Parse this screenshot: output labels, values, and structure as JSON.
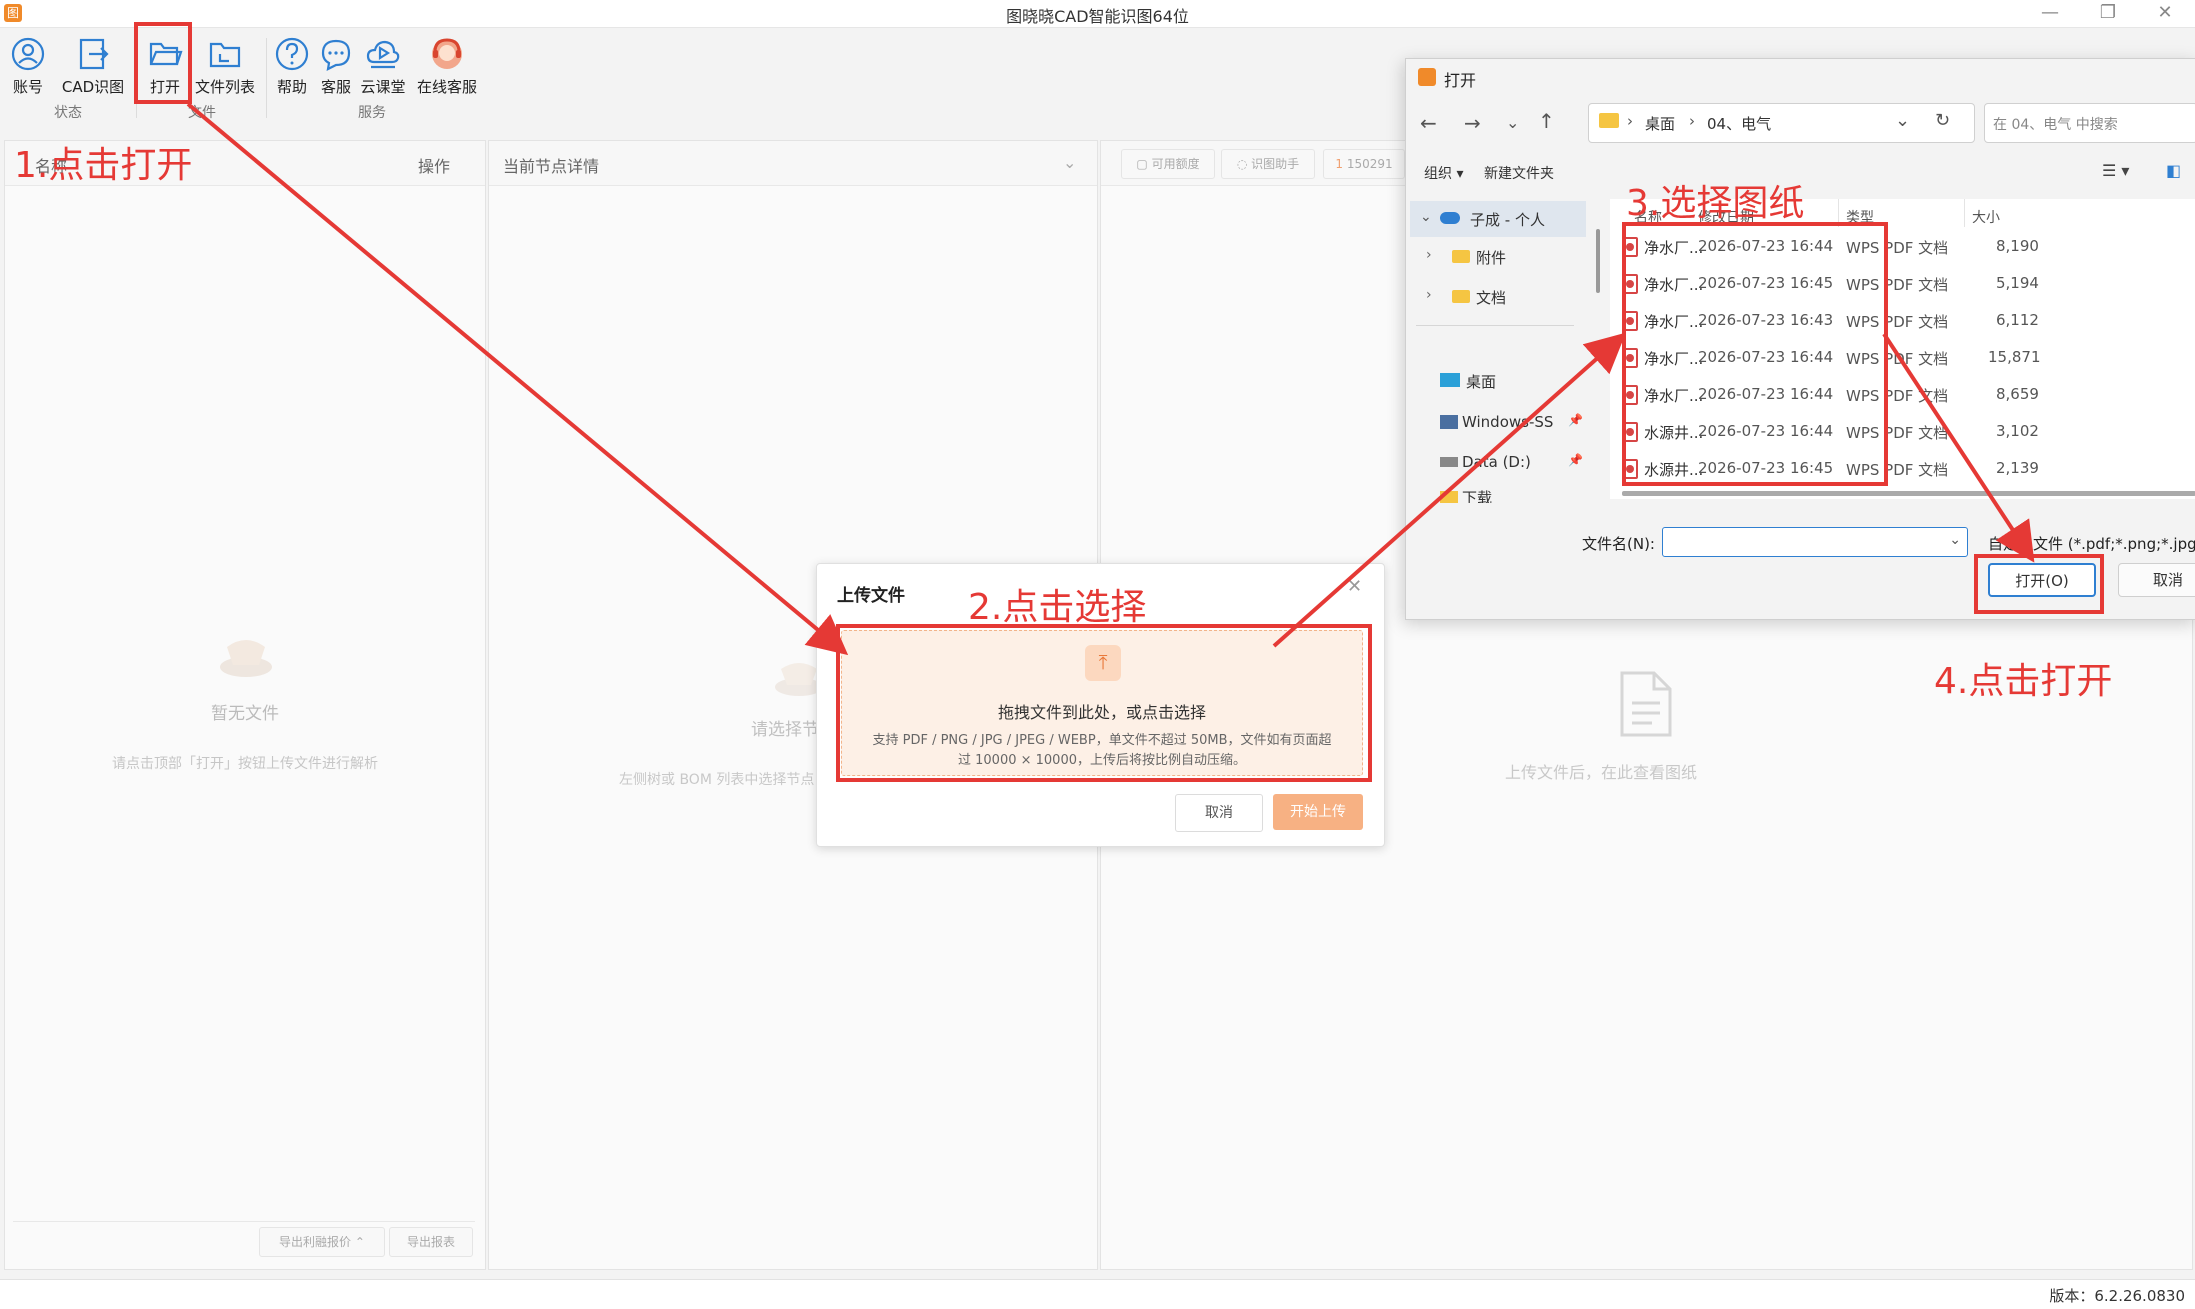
{
  "app": {
    "title": "图晓晓CAD智能识图64位",
    "version_label": "版本：6.2.26.0830"
  },
  "toolbar": {
    "items": [
      {
        "label": "账号"
      },
      {
        "label": "CAD识图"
      },
      {
        "label": "打开"
      },
      {
        "label": "文件列表"
      },
      {
        "label": "帮助"
      },
      {
        "label": "客服"
      },
      {
        "label": "云课堂"
      },
      {
        "label": "在线客服"
      }
    ],
    "groups": [
      "状态",
      "文件",
      "服务"
    ]
  },
  "left_panel": {
    "header_name": "名称",
    "header_action": "操作",
    "empty_title": "暂无文件",
    "empty_hint": "请点击顶部「打开」按钮上传文件进行解析",
    "btn_export_quote": "导出利融报价",
    "btn_export_report": "导出报表"
  },
  "mid_panel": {
    "header": "当前节点详情",
    "empty_title": "请选择节",
    "empty_hint": "左侧树或 BOM 列表中选择节点"
  },
  "right_panel": {
    "chip1": "可用额度",
    "chip2": "识图助手",
    "chip3_badge": "1",
    "chip3": "150291",
    "empty_hint": "上传文件后，在此查看图纸"
  },
  "upload_modal": {
    "title": "上传文件",
    "drop_main": "拖拽文件到此处，或点击选择",
    "drop_sub1": "支持 PDF / PNG / JPG / JPEG / WEBP，单文件不超过 50MB，文件如有页面超",
    "drop_sub2": "过 10000 × 10000，上传后将按比例自动压缩。",
    "cancel": "取消",
    "start": "开始上传"
  },
  "file_dialog": {
    "title": "打开",
    "path": [
      "桌面",
      "04、电气"
    ],
    "search_placeholder": "在 04、电气 中搜索",
    "organize": "组织 ▾",
    "new_folder": "新建文件夹",
    "nav": [
      {
        "label": "子成 - 个人"
      },
      {
        "label": "附件"
      },
      {
        "label": "文档"
      },
      {
        "label": "桌面"
      },
      {
        "label": "Windows-SS"
      },
      {
        "label": "Data (D:)"
      },
      {
        "label": "下载"
      }
    ],
    "columns": {
      "name": "名称",
      "date": "修改日期",
      "type": "类型",
      "size": "大小"
    },
    "files": [
      {
        "name": "净水厂...",
        "date": "2026-07-23 16:44",
        "type": "WPS PDF 文档",
        "size": "8,190"
      },
      {
        "name": "净水厂...",
        "date": "2026-07-23 16:45",
        "type": "WPS PDF 文档",
        "size": "5,194"
      },
      {
        "name": "净水厂...",
        "date": "2026-07-23 16:43",
        "type": "WPS PDF 文档",
        "size": "6,112"
      },
      {
        "name": "净水厂...",
        "date": "2026-07-23 16:44",
        "type": "WPS PDF 文档",
        "size": "15,871"
      },
      {
        "name": "净水厂...",
        "date": "2026-07-23 16:44",
        "type": "WPS PDF 文档",
        "size": "8,659"
      },
      {
        "name": "水源井...",
        "date": "2026-07-23 16:44",
        "type": "WPS PDF 文档",
        "size": "3,102"
      },
      {
        "name": "水源井...",
        "date": "2026-07-23 16:45",
        "type": "WPS PDF 文档",
        "size": "2,139"
      }
    ],
    "filename_label": "文件名(N):",
    "filetype": "自定义文件 (*.pdf;*.png;*.jpg",
    "open": "打开(O)",
    "cancel": "取消"
  },
  "annotations": {
    "step1": "1.点击打开",
    "step2": "2.点击选择",
    "step3": "3.选择图纸",
    "step4": "4.点击打开",
    "color": "#e53935"
  }
}
